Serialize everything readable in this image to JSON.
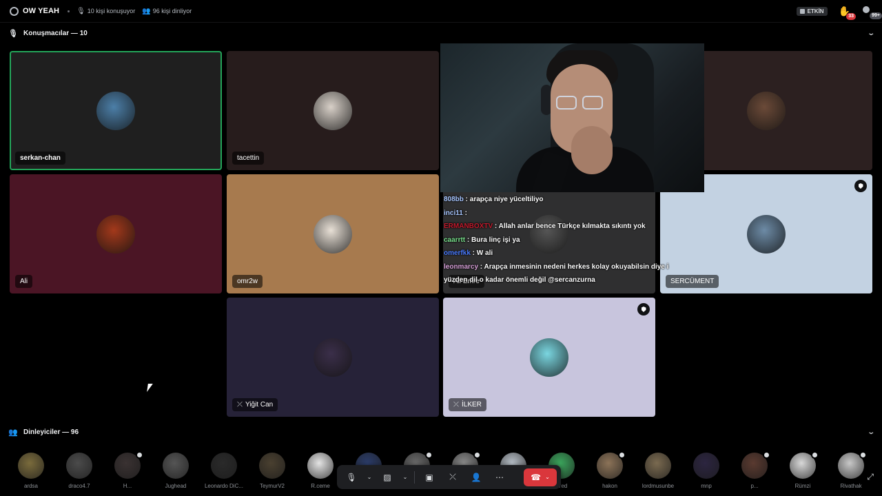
{
  "topbar": {
    "title": "OW YEAH",
    "speakers_info": "10 kişi konuşuyor",
    "listeners_info": "96 kişi dinliyor",
    "event_label": "ETKİN",
    "hand_count": "33",
    "people_count": "99+"
  },
  "speakers_section": {
    "label": "Konuşmacılar — 10"
  },
  "listeners_section": {
    "label": "Dinleyiciler — 96"
  },
  "tiles": [
    {
      "name": "serkan-chan",
      "bg": "#1f1f1f",
      "avatar_color": "#4c7fa8",
      "speaking": true
    },
    {
      "name": "tacettin",
      "bg": "#271c1c",
      "avatar_color": "#d8d0c8"
    },
    {
      "name": "",
      "bg": "#2c2020",
      "avatar_color": "#6b4a38"
    },
    {
      "name": "Ali",
      "bg": "#4b1525",
      "avatar_color": "#a3391b"
    },
    {
      "name": "omr2w",
      "bg": "#a77a4e",
      "avatar_color": "#e8e0d6"
    },
    {
      "name": "Ali Emre",
      "bg": "#2f2f30",
      "avatar_color": "#565656"
    },
    {
      "name": "SERCÜMENT",
      "bg": "#c3d2e2",
      "avatar_color": "#6d8ba6",
      "moderator": true
    },
    {
      "name": "Yiğit Can",
      "bg": "#262238",
      "avatar_color": "#3b2f4a",
      "muted": true
    },
    {
      "name": "İLKER",
      "bg": "#c8c5dd",
      "avatar_color": "#7ad6e0",
      "muted": true,
      "moderator": true
    }
  ],
  "chat": [
    {
      "user": "808bb",
      "color": "#a8c6ff",
      "text": " : arapça niye yüceltiliyo"
    },
    {
      "user": "inci11",
      "color": "#a8c6ff",
      "text": " :"
    },
    {
      "user": "ERMANBOXTV",
      "color": "#c21a2c",
      "text": " : Allah anlar bence Türkçe kılmakta sıkıntı yok"
    },
    {
      "user": "caarrtt",
      "color": "#79e08c",
      "text": " : Bura linç işi ya"
    },
    {
      "user": "omerfkk",
      "color": "#4a7bff",
      "text": " : W ali"
    },
    {
      "user": "leonmarcy",
      "color": "#d7a0d8",
      "text": " : Arapça inmesinin nedeni herkes kolay okuyabilsin diye i"
    },
    {
      "user": "",
      "color": "#ffffff",
      "text": "yüzden dil o kadar önemli değil @sercanzurna"
    }
  ],
  "listeners": [
    {
      "name": "ardsa",
      "color": "#7a6b3c"
    },
    {
      "name": "draco4.7",
      "color": "#4b4b4b"
    },
    {
      "name": "H...",
      "color": "#3a3232",
      "hand": true
    },
    {
      "name": "Jughead",
      "color": "#555555"
    },
    {
      "name": "Leonardo DiC...",
      "color": "#2a2a2a"
    },
    {
      "name": "TeymurV2",
      "color": "#4a4030"
    },
    {
      "name": "R.ceme",
      "color": "#e4e4e4"
    },
    {
      "name": "",
      "color": "#2c3d6a"
    },
    {
      "name": "",
      "color": "#6a6a6a",
      "hand": true
    },
    {
      "name": "",
      "color": "#8a8a8a",
      "hand": true
    },
    {
      "name": "",
      "color": "#b8c0c8"
    },
    {
      "name": "Fred",
      "color": "#3ba55c"
    },
    {
      "name": "hakon",
      "color": "#8c7358",
      "hand": true
    },
    {
      "name": "lordmusunbe",
      "color": "#7a6a50"
    },
    {
      "name": "mnp",
      "color": "#2c2540"
    },
    {
      "name": "p...",
      "color": "#5a3a30",
      "hand": true
    },
    {
      "name": "Rümzi",
      "color": "#d8d8d8",
      "hand": true
    },
    {
      "name": "Rivathak",
      "color": "#c8c8c8",
      "hand": true
    }
  ],
  "controls": {
    "mic": "🎙",
    "chevron": "⌄",
    "camera": "▨",
    "screen": "▣",
    "mute_stage": "⤫",
    "invite": "👤",
    "more": "⋯",
    "leave": "☎"
  },
  "icons": {
    "stage": "stage-icon",
    "hand": "raise-hand-icon",
    "expand": "expand-icon"
  }
}
